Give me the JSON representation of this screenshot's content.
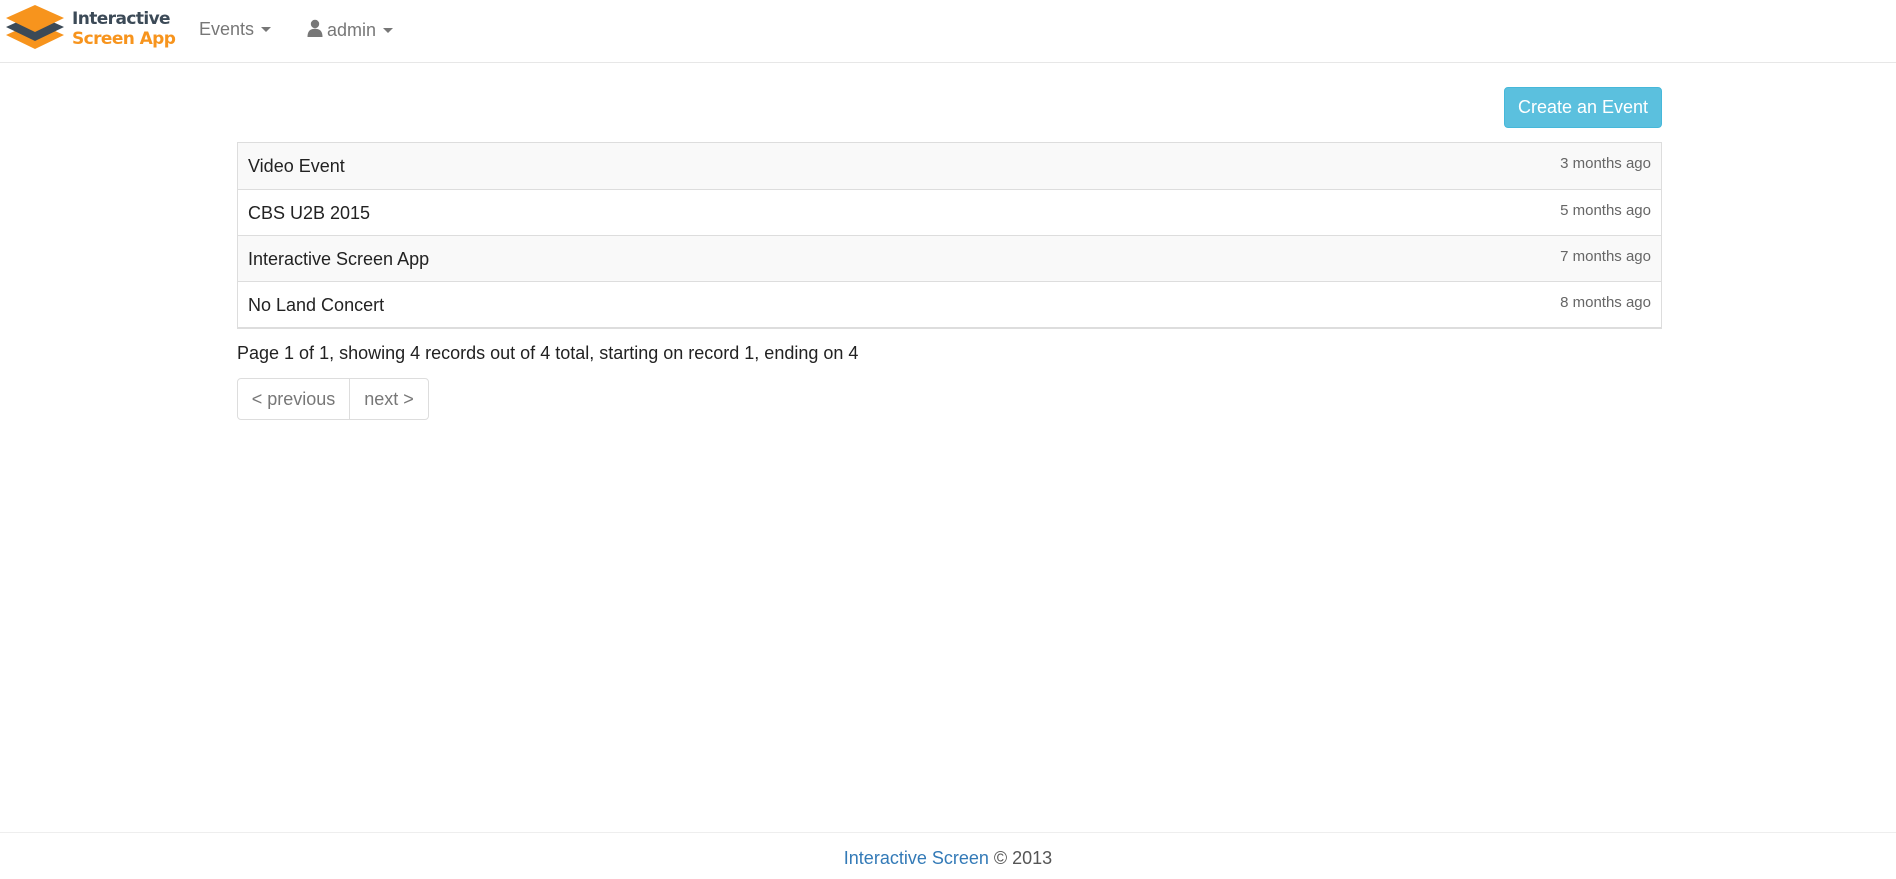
{
  "brand": {
    "line1": "Interactive",
    "line2": "Screen App",
    "color_dark": "#3c4a57",
    "color_orange": "#f7941d"
  },
  "nav": {
    "events_label": "Events",
    "user_label": "admin",
    "user_icon": "user-icon"
  },
  "actions": {
    "create_label": "Create an Event",
    "create_color": "#5bc0de"
  },
  "events": [
    {
      "title": "Video Event",
      "time": "3 months ago"
    },
    {
      "title": "CBS U2B 2015",
      "time": "5 months ago"
    },
    {
      "title": "Interactive Screen App",
      "time": "7 months ago"
    },
    {
      "title": "No Land Concert",
      "time": "8 months ago"
    }
  ],
  "paging": {
    "info": "Page 1 of 1, showing 4 records out of 4 total, starting on record 1, ending on 4",
    "prev_label": "< previous",
    "next_label": "next >"
  },
  "footer": {
    "link_text": "Interactive Screen",
    "copyright": " © 2013",
    "link_color": "#337ab7"
  }
}
